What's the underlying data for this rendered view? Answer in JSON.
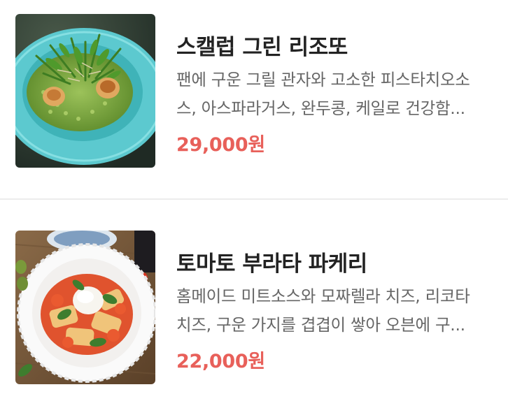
{
  "menu": {
    "items": [
      {
        "image_icon": "scallop-risotto-photo",
        "title": "스캘럽 그린 리조또",
        "desc_line1": "팬에 구운 그릴 관자와 고소한 피스타치오소",
        "desc_line2": "스, 아스파라거스, 완두콩, 케일로 건강함...",
        "price": "29,000원"
      },
      {
        "image_icon": "tomato-burrata-paccheri-photo",
        "title": "토마토 부라타 파케리",
        "desc_line1": "홈메이드 미트소스와 모짜렐라 치즈, 리코타",
        "desc_line2": "치즈, 구운 가지를 겹겹이 쌓아 오븐에 구...",
        "price": "22,000원"
      }
    ]
  },
  "colors": {
    "price": "#e8605a",
    "title": "#222222",
    "description": "#666666",
    "divider": "#ececec"
  }
}
